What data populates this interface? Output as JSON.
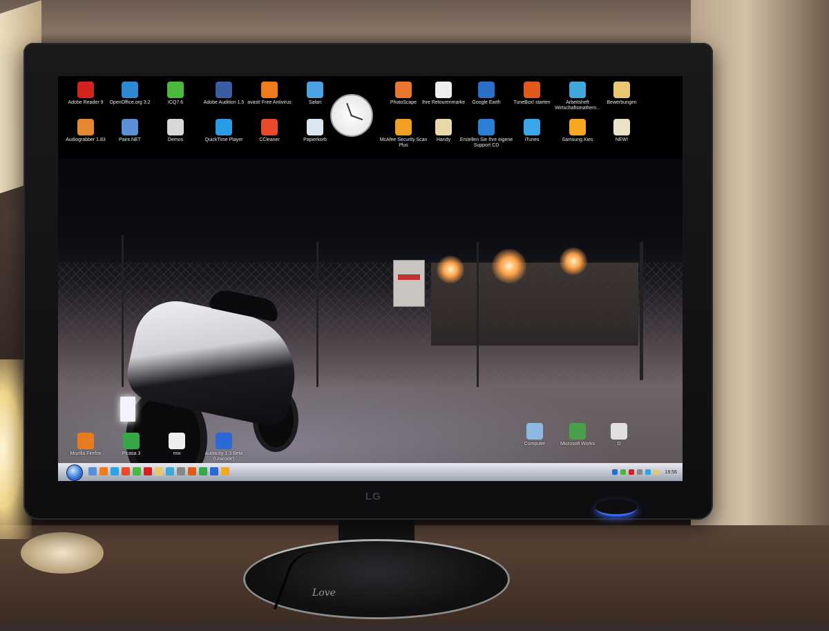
{
  "desktop": {
    "icons_top_row": [
      {
        "label": "Adobe Reader 9",
        "icon": "adobe-reader-icon",
        "color": "#d2231e"
      },
      {
        "label": "OpenOffice.org 3.2",
        "icon": "openoffice-icon",
        "color": "#2f8ad6"
      },
      {
        "label": "ICQ7.6",
        "icon": "icq-flower-icon",
        "color": "#4ab83b"
      },
      {
        "label": "Adobe Audition 1.5",
        "icon": "adobe-audition-icon",
        "color": "#3a5da6"
      },
      {
        "label": "avast! Free Antivirus",
        "icon": "avast-icon",
        "color": "#f07b1a"
      },
      {
        "label": "Safari",
        "icon": "safari-compass-icon",
        "color": "#4aa3e0"
      },
      {
        "label": "PhotoScape",
        "icon": "photoscape-icon",
        "color": "#e9762e"
      },
      {
        "label": "Ihre Retourenmarke",
        "icon": "document-icon",
        "color": "#eeeeee"
      },
      {
        "label": "Google Earth",
        "icon": "google-earth-icon",
        "color": "#2b6fc8"
      },
      {
        "label": "TuneBox! starten",
        "icon": "tunebox-icon",
        "color": "#e05a1c"
      },
      {
        "label": "Arbeitsheft Wirtschaftsmathem...",
        "icon": "shortcut-icon",
        "color": "#3fa7d9"
      },
      {
        "label": "Bewerbungen",
        "icon": "folder-icon",
        "color": "#e9c770"
      }
    ],
    "icons_second_row": [
      {
        "label": "Audiograbber 1.83",
        "icon": "audiograbber-icon",
        "color": "#e4872e"
      },
      {
        "label": "Paint.NET",
        "icon": "paint-net-icon",
        "color": "#5a8fd6"
      },
      {
        "label": "Demos",
        "icon": "folder-icon",
        "color": "#d8d8d8"
      },
      {
        "label": "QuickTime Player",
        "icon": "quicktime-icon",
        "color": "#2a9be6"
      },
      {
        "label": "CCleaner",
        "icon": "ccleaner-icon",
        "color": "#e84a2a"
      },
      {
        "label": "Papierkorb",
        "icon": "recycle-bin-icon",
        "color": "#d9e6ef"
      },
      {
        "label": "McAfee Security Scan Plus",
        "icon": "mcafee-icon",
        "color": "#f0a020"
      },
      {
        "label": "Handy",
        "icon": "folder-icon",
        "color": "#e9d9a8"
      },
      {
        "label": "Erstellen Sie Ihre eigene Support CD",
        "icon": "support-cd-icon",
        "color": "#2e7dd6"
      },
      {
        "label": "iTunes",
        "icon": "itunes-icon",
        "color": "#3aa6e8"
      },
      {
        "label": "Samsung Kies",
        "icon": "samsung-kies-icon",
        "color": "#f5a623"
      },
      {
        "label": "NEW!",
        "icon": "folder-icon",
        "color": "#e9e1c8"
      }
    ],
    "icons_bottom_left": [
      {
        "label": "Mozilla Firefox",
        "icon": "firefox-icon",
        "color": "#e87a20"
      },
      {
        "label": "Picasa 3",
        "icon": "picasa-icon",
        "color": "#37a847"
      },
      {
        "label": "mix",
        "icon": "document-icon",
        "color": "#eeeeee"
      },
      {
        "label": "Audacity 1.3 Beta (Unicode)",
        "icon": "audacity-icon",
        "color": "#2a6ad6"
      }
    ],
    "icons_bottom_right": [
      {
        "label": "Computer",
        "icon": "computer-icon",
        "color": "#8fb8e0"
      },
      {
        "label": "Microsoft Works",
        "icon": "microsoft-works-icon",
        "color": "#4aa14a"
      },
      {
        "label": "D",
        "icon": "document-icon",
        "color": "#e0e0e0"
      }
    ],
    "clock_gadget": {
      "icon": "analog-clock-icon"
    }
  },
  "taskbar": {
    "start_icon": "windows-start-orb-icon",
    "quicklaunch_colors": [
      "#5a8fd6",
      "#f07b1a",
      "#2aa6e8",
      "#e84a2a",
      "#4ab83b",
      "#d2231e",
      "#e9c770",
      "#3fa7d9",
      "#888888",
      "#e05a1c",
      "#37a847",
      "#2a6ad6",
      "#f5a623"
    ],
    "tray_colors": [
      "#2a6ad6",
      "#4ab83b",
      "#d2231e",
      "#888888",
      "#2aa6e8",
      "#e9c770"
    ],
    "time": "19:56"
  },
  "monitor": {
    "brand": "LG",
    "stand_text": "Love",
    "power_led_color": "#3b6cff"
  }
}
